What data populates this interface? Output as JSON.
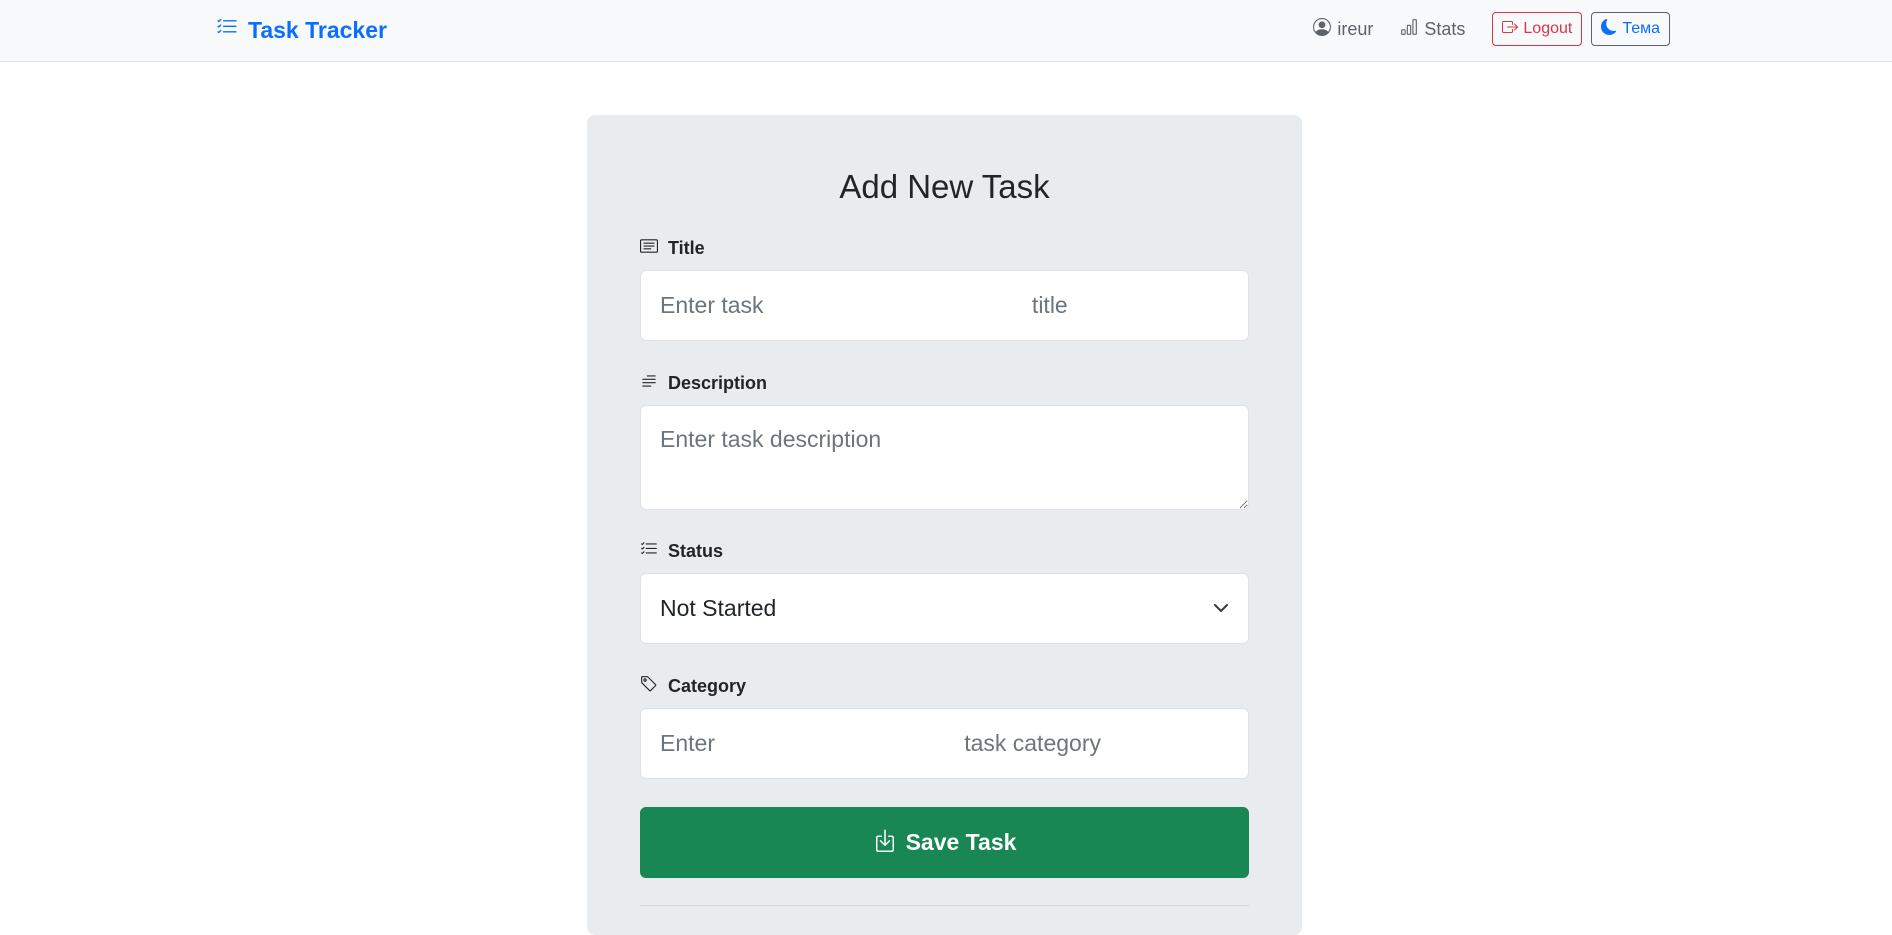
{
  "navbar": {
    "brand": "Task Tracker",
    "username": "ireur",
    "stats_label": "Stats",
    "logout_label": "Logout",
    "theme_label": "Тема"
  },
  "form": {
    "heading": "Add New Task",
    "title_label": "Title",
    "title_placeholder": "Enter task                                          title",
    "description_label": "Description",
    "description_placeholder": "Enter task description",
    "status_label": "Status",
    "status_value": "Not Started",
    "category_label": "Category",
    "category_placeholder": "Enter                                       task category",
    "save_label": "Save Task"
  },
  "colors": {
    "brand": "#0d6efd",
    "danger": "#dc3545",
    "success": "#198754",
    "card_bg": "#e9ecef"
  },
  "icons": {
    "brand": "list-check-icon",
    "user": "person-circle-icon",
    "stats": "bar-chart-icon",
    "logout": "box-arrow-right-icon",
    "theme": "moon-icon",
    "title": "card-text-icon",
    "description": "text-paragraph-icon",
    "status": "list-check-icon",
    "category": "tag-icon",
    "save": "box-arrow-in-down-icon"
  }
}
